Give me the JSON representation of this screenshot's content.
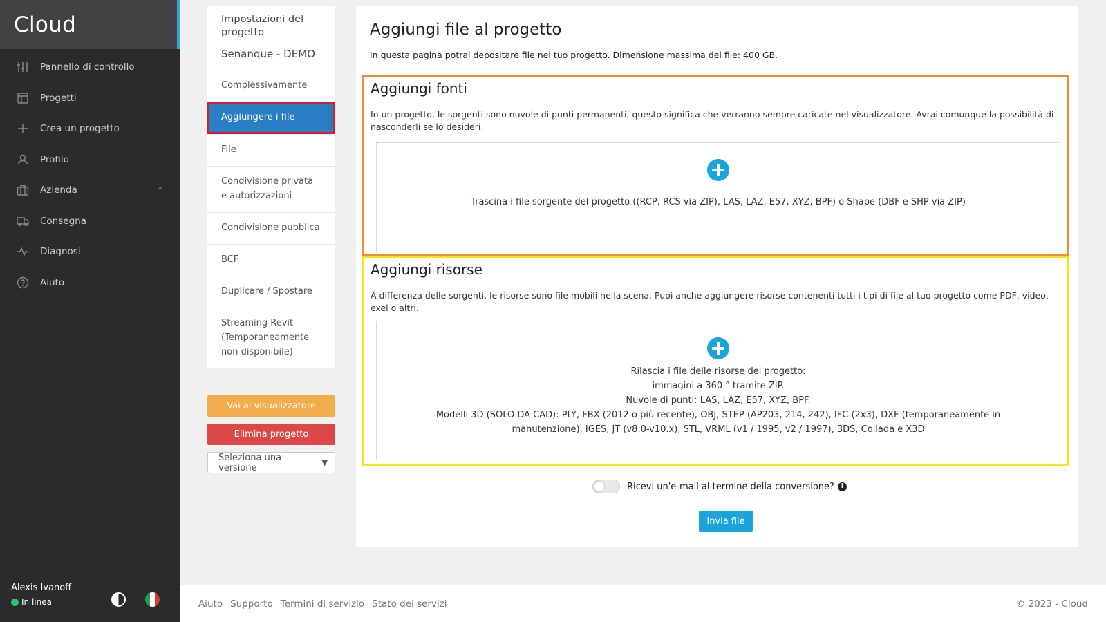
{
  "sidebar": {
    "brand": "Cloud",
    "items": [
      {
        "label": "Pannello di controllo",
        "icon": "sliders-icon"
      },
      {
        "label": "Progetti",
        "icon": "layout-icon"
      },
      {
        "label": "Crea un progetto",
        "icon": "plus-icon"
      },
      {
        "label": "Profilo",
        "icon": "user-icon"
      },
      {
        "label": "Azienda",
        "icon": "briefcase-icon"
      },
      {
        "label": "Consegna",
        "icon": "truck-icon"
      },
      {
        "label": "Diagnosi",
        "icon": "activity-icon"
      },
      {
        "label": "Aiuto",
        "icon": "help-circle-icon"
      }
    ],
    "user": {
      "name": "Alexis Ivanoff",
      "status": "In linea"
    }
  },
  "submenu": {
    "heading": "Impostazioni del progetto",
    "project": "Senanque - DEMO",
    "items": [
      "Complessivamente",
      "Aggiungere i file",
      "File",
      "Condivisione privata e autorizzazioni",
      "Condivisione pubblica",
      "BCF",
      "Duplicare / Spostare",
      "Streaming Revit (Temporaneamente non disponibile)"
    ],
    "viewer_button": "Vai al visualizzatore",
    "delete_button": "Elimina progetto",
    "version_select": "Seleziona una versione"
  },
  "main": {
    "title": "Aggiungi file al progetto",
    "description": "In questa pagina potrai depositare file nel tuo progetto. Dimensione massima del file: 400 GB.",
    "sources": {
      "title": "Aggiungi fonti",
      "text": "In un progetto, le sorgenti sono nuvole di punti permanenti, questo significa che verranno sempre caricate nel visualizzatore. Avrai comunque la possibilità di nasconderli se lo desideri.",
      "dropzone": "Trascina i file sorgente del progetto ((RCP, RCS via ZIP), LAS, LAZ, E57, XYZ, BPF) o Shape (DBF e SHP via ZIP)"
    },
    "resources": {
      "title": "Aggiungi risorse",
      "text": "A differenza delle sorgenti, le risorse sono file mobili nella scena. Puoi anche aggiungere risorse contenenti tutti i tipi di file al tuo progetto come PDF, video, exel o altri.",
      "dropzone_lines": [
        "Rilascia i file delle risorse del progetto:",
        "immagini a 360 ° tramite ZIP.",
        "Nuvole di punti: LAS, LAZ, E57, XYZ, BPF.",
        "Modelli 3D (SOLO DA CAD): PLY, FBX (2012 o più recente), OBJ, STEP (AP203, 214, 242), IFC (2x3), DXF (temporaneamente in manutenzione), IGES, JT (v8.0-v10.x), STL, VRML (v1 / 1995, v2 / 1997), 3DS, Collada e X3D"
      ]
    },
    "email_toggle": "Ricevi un'e-mail al termine della conversione?",
    "send_button": "Invia file"
  },
  "footer": {
    "links": [
      "Aiuto",
      "Supporto",
      "Termini di servizio",
      "Stato dei servizi"
    ],
    "copyright": "© 2023 - Cloud"
  },
  "colors": {
    "accent": "#19a4dc",
    "sources_border": "#f08c32",
    "resources_border": "#f7e21b",
    "active_item": "#2a7fc4",
    "viewer_button": "#f2ac4b",
    "delete_button": "#dc4848"
  }
}
